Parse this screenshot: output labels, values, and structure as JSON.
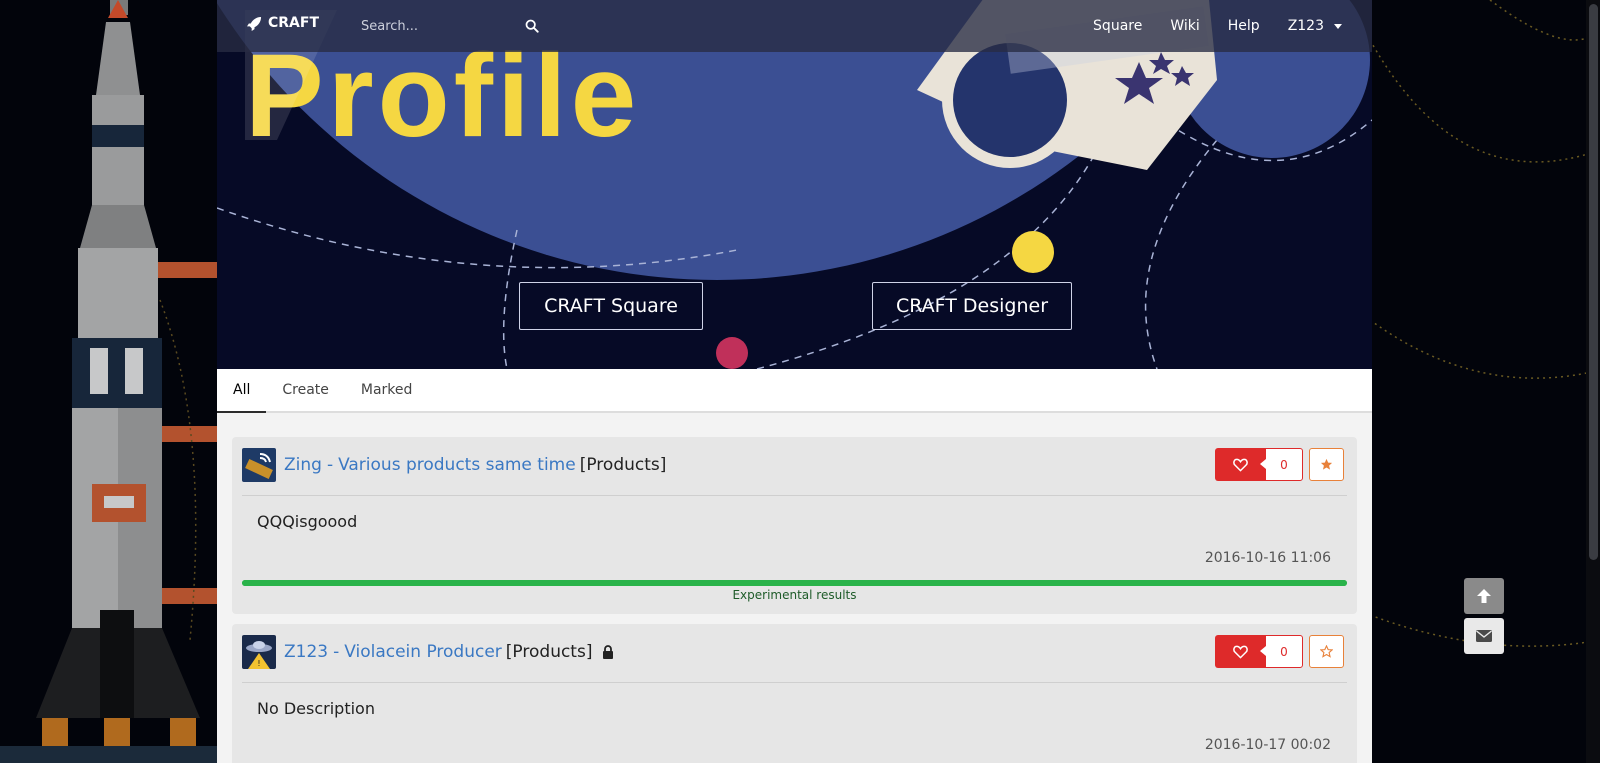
{
  "navbar": {
    "brand": "CRAFT",
    "search_placeholder": "Search...",
    "links": [
      "Square",
      "Wiki",
      "Help"
    ],
    "user": "Z123"
  },
  "hero": {
    "title": "Profile",
    "buttons": [
      "CRAFT Square",
      "CRAFT Designer"
    ]
  },
  "tabs": [
    {
      "label": "All",
      "active": true
    },
    {
      "label": "Create",
      "active": false
    },
    {
      "label": "Marked",
      "active": false
    }
  ],
  "cards": [
    {
      "author": "Zing",
      "separator": "-",
      "title": "Various products same time",
      "tag": "[Products]",
      "locked": false,
      "likes": "0",
      "starred": true,
      "description": "QQQisgoood",
      "time": "2016-10-16 11:06",
      "progress": 1.0,
      "progress_label": "Experimental results"
    },
    {
      "author": "Z123",
      "separator": "-",
      "title": "Violacein Producer",
      "tag": "[Products]",
      "locked": true,
      "likes": "0",
      "starred": false,
      "description": "No Description",
      "time": "2016-10-17 00:02"
    }
  ],
  "colors": {
    "like": "#de2a2a",
    "star": "#e8813a",
    "link": "#3a78c3",
    "progress": "#2ab34a",
    "hero_title": "#f5d742"
  },
  "icons": [
    "rocket-icon",
    "search-icon",
    "caret-down-icon",
    "heart-icon",
    "star-icon",
    "lock-icon",
    "arrow-up-icon",
    "envelope-icon"
  ]
}
